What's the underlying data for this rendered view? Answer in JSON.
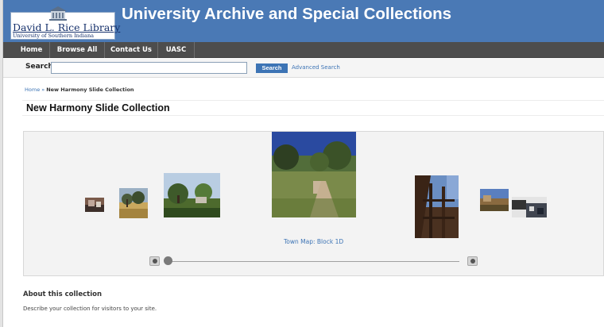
{
  "header": {
    "logo_name": "David L. Rice Library",
    "logo_sub": "University of Southern Indiana",
    "site_title": "University Archive and Special Collections"
  },
  "nav": {
    "items": [
      {
        "label": "Home"
      },
      {
        "label": "Browse All"
      },
      {
        "label": "Contact Us"
      },
      {
        "label": "UASC"
      }
    ]
  },
  "search": {
    "label": "Search",
    "value": "",
    "placeholder": "",
    "button_label": "Search",
    "advanced_label": "Advanced Search"
  },
  "breadcrumb": {
    "home": "Home",
    "separator": "»",
    "current": "New Harmony Slide Collection"
  },
  "page": {
    "title": "New Harmony Slide Collection"
  },
  "coverflow": {
    "caption": "Town Map: Block 1D"
  },
  "about": {
    "heading": "About this collection",
    "text": "Describe your collection for visitors to your site."
  },
  "colors": {
    "header_blue": "#4a79b5",
    "nav_dark": "#4d4d4d",
    "link_blue": "#3d74b5"
  }
}
